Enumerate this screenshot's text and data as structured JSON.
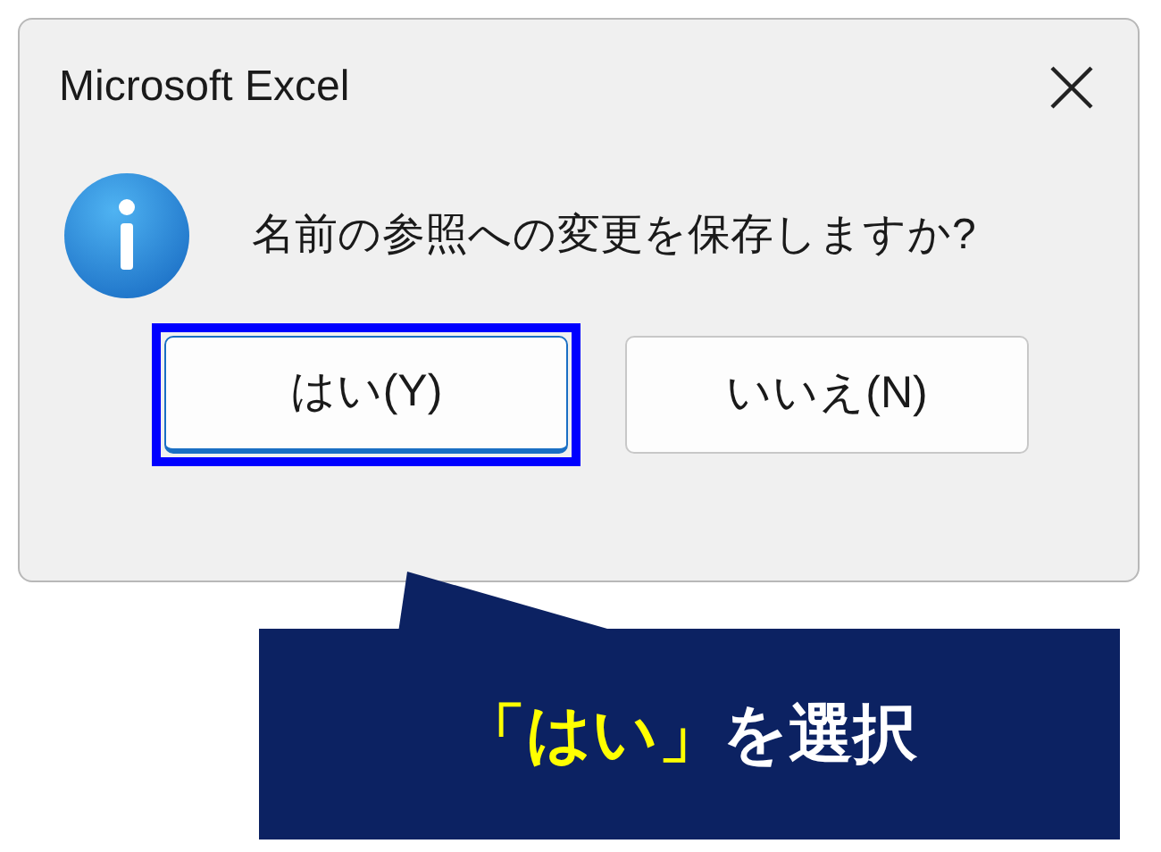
{
  "window": {
    "title": "Microsoft Excel"
  },
  "message": "名前の参照への変更を保存しますか?",
  "buttons": [
    {
      "label": "はい(Y)",
      "selected": true
    },
    {
      "label": "いいえ(N)",
      "selected": false
    }
  ],
  "callout": {
    "parts": [
      {
        "text": "「はい」",
        "highlight": true
      },
      {
        "text": "を選択",
        "highlight": false
      }
    ]
  }
}
